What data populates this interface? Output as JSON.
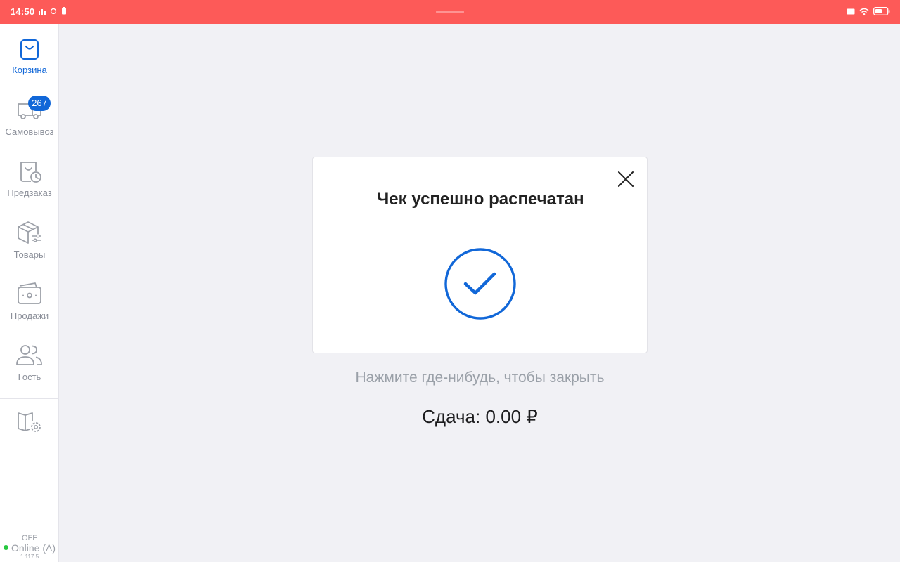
{
  "status_bar": {
    "time": "14:50",
    "bg_color": "#fd5a58",
    "left_icons": [
      "signal-icon",
      "sync-icon",
      "battery-saver-icon"
    ],
    "right_icons": [
      "message-icon",
      "wifi-icon",
      "battery-icon"
    ]
  },
  "sidebar": {
    "accent_color": "#1167d8",
    "items": [
      {
        "label": "Корзина",
        "icon": "shopping-bag-icon",
        "active": true
      },
      {
        "label": "Самовывоз",
        "icon": "truck-icon",
        "badge": "267"
      },
      {
        "label": "Предзаказ",
        "icon": "bag-clock-icon"
      },
      {
        "label": "Товары",
        "icon": "box-settings-icon"
      },
      {
        "label": "Продажи",
        "icon": "wallet-icon"
      },
      {
        "label": "Гость",
        "icon": "users-icon"
      }
    ],
    "settings_icon": "book-gear-icon",
    "connection": {
      "off_label": "OFF",
      "online_label": "Online (A)",
      "status_color": "#28c840",
      "version": "1.117.5"
    }
  },
  "dialog": {
    "title": "Чек успешно распечатан",
    "success_icon": "check-circle-icon",
    "close_icon": "close-icon"
  },
  "hint": "Нажмите где-нибудь, чтобы закрыть",
  "change_text": "Сдача: 0.00 ₽"
}
